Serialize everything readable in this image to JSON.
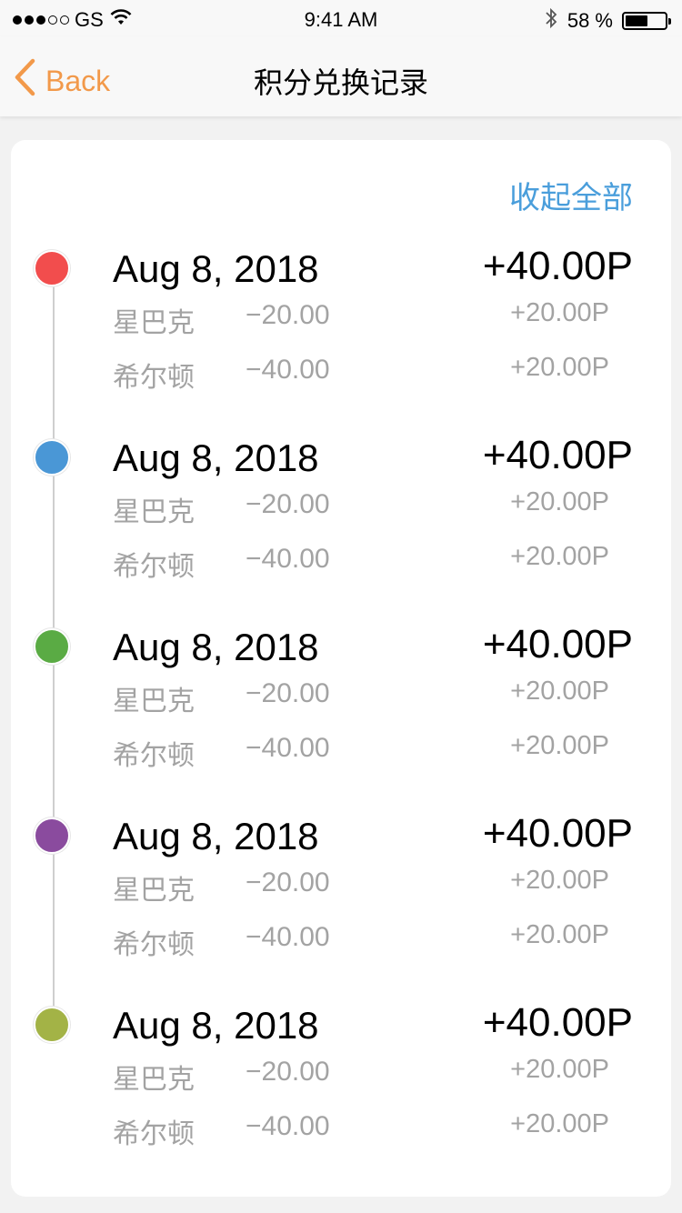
{
  "status_bar": {
    "carrier": "GS",
    "signal_filled": 3,
    "signal_total": 5,
    "time": "9:41 AM",
    "battery_text": "58 %",
    "battery_level": 0.58
  },
  "nav": {
    "back_label": "Back",
    "title": "积分兑换记录"
  },
  "collapse_label": "收起全部",
  "entries": [
    {
      "color": "#f24d4d",
      "date": "Aug 8, 2018",
      "total": "+40.00P",
      "items": [
        {
          "name": "星巴克",
          "amount": "−20.00",
          "points": "+20.00P"
        },
        {
          "name": "希尔顿",
          "amount": "−40.00",
          "points": "+20.00P"
        }
      ]
    },
    {
      "color": "#4a97d6",
      "date": "Aug 8, 2018",
      "total": "+40.00P",
      "items": [
        {
          "name": "星巴克",
          "amount": "−20.00",
          "points": "+20.00P"
        },
        {
          "name": "希尔顿",
          "amount": "−40.00",
          "points": "+20.00P"
        }
      ]
    },
    {
      "color": "#5aab44",
      "date": "Aug 8, 2018",
      "total": "+40.00P",
      "items": [
        {
          "name": "星巴克",
          "amount": "−20.00",
          "points": "+20.00P"
        },
        {
          "name": "希尔顿",
          "amount": "−40.00",
          "points": "+20.00P"
        }
      ]
    },
    {
      "color": "#8a4b9e",
      "date": "Aug 8, 2018",
      "total": "+40.00P",
      "items": [
        {
          "name": "星巴克",
          "amount": "−20.00",
          "points": "+20.00P"
        },
        {
          "name": "希尔顿",
          "amount": "−40.00",
          "points": "+20.00P"
        }
      ]
    },
    {
      "color": "#a3b346",
      "date": "Aug 8, 2018",
      "total": "+40.00P",
      "items": [
        {
          "name": "星巴克",
          "amount": "−20.00",
          "points": "+20.00P"
        },
        {
          "name": "希尔顿",
          "amount": "−40.00",
          "points": "+20.00P"
        }
      ]
    }
  ],
  "colors": {
    "accent_orange": "#f2994a",
    "link_blue": "#4a9edb",
    "secondary_text": "#a3a3a3"
  }
}
